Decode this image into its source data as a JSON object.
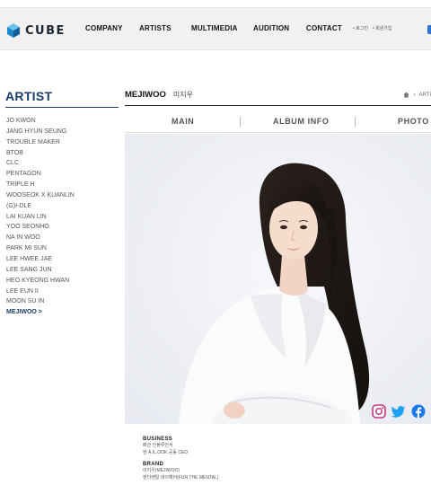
{
  "header": {
    "logo_text": "CUBE",
    "nav": [
      "COMPANY",
      "ARTISTS",
      "MULTIMEDIA",
      "AUDITION",
      "CONTACT"
    ],
    "utility_links": [
      "• 로그인",
      "• 회원가입"
    ]
  },
  "sidebar": {
    "title": "ARTIST",
    "artists": [
      "JO KWON",
      "JANG HYUN SEUNG",
      "TROUBLE MAKER",
      "BTOB",
      "CLC",
      "PENTAGON",
      "TRIPLE H",
      "WOOSEOK X KUANLIN",
      "(G)I-DLE",
      "LAI KUAN LIN",
      "YOO SEONHO",
      "NA IN WOO",
      "PARK MI SUN",
      "LEE HWEE JAE",
      "LEE SANG JUN",
      "HEO KYEONG HWAN",
      "LEE EUN II",
      "MOON SU IN",
      "MEJIWOO  >"
    ],
    "active_index": 18
  },
  "main": {
    "artist_name_en": "MEJIWOO",
    "artist_name_ko": "미지우",
    "breadcrumb": "ARTI",
    "tabs": [
      "MAIN",
      "ALBUM INFO",
      "PHOTO"
    ]
  },
  "social": [
    "instagram-icon",
    "twitter-icon",
    "facebook-icon"
  ],
  "info": {
    "business_title": "BUSINESS",
    "business_lines": [
      "패션 인플루언서",
      "현  A.IL.OOK 공동 CEO"
    ],
    "brand_title": "BRAND",
    "brand_lines": [
      "미지우(MEJIWOO)",
      "펀더멘탈 대이해어(FUN THE MENTAL)"
    ]
  },
  "colors": {
    "header_bg": "#f1f1f1",
    "brand_navy": "#1c3c6b",
    "photo_bg": "#eef0f4"
  }
}
